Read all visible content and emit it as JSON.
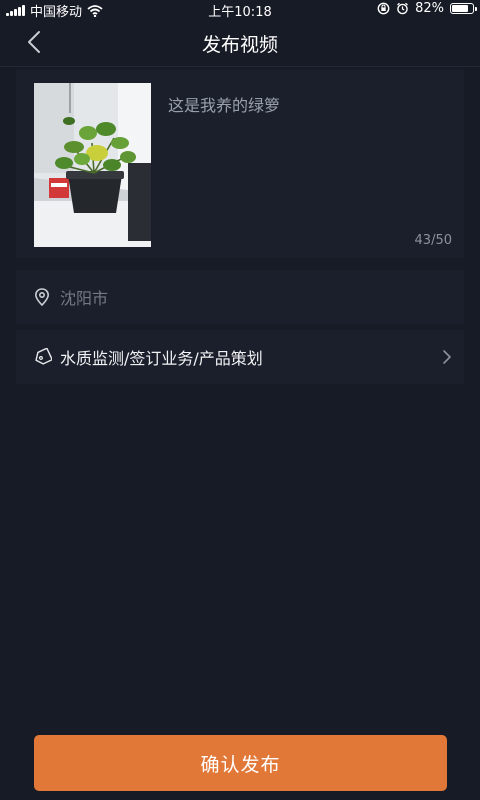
{
  "status_bar": {
    "carrier": "中国移动",
    "time": "上午10:18",
    "battery": "82%",
    "battery_level": 0.82,
    "icons": [
      "signal-icon",
      "wifi-icon",
      "rotation-lock-icon",
      "alarm-icon",
      "battery-icon"
    ]
  },
  "nav": {
    "title": "发布视频",
    "back_icon": "chevron-left-icon"
  },
  "composer": {
    "caption": "这是我养的绿箩",
    "counter": "43/50",
    "thumbnail": "potted-plant-photo"
  },
  "location": {
    "icon": "location-pin-icon",
    "text": "沈阳市"
  },
  "tags": {
    "icon": "tag-icon",
    "text": "水质监测/签订业务/产品策划",
    "chevron_icon": "chevron-right-icon"
  },
  "confirm": {
    "label": "确认发布"
  },
  "colors": {
    "background": "#171b26",
    "card": "#1a1f2b",
    "accent": "#e27838",
    "muted_text": "#747a85"
  }
}
